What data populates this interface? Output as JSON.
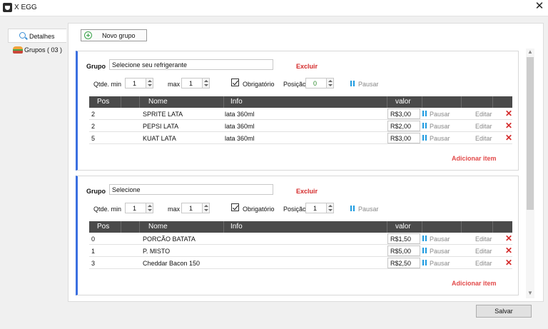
{
  "window": {
    "title": "X EGG",
    "close_glyph": "✕"
  },
  "nav": {
    "items": [
      {
        "label": "Detalhes",
        "icon": "search-icon",
        "active": true
      },
      {
        "label": "Grupos  ( 03 )",
        "icon": "burger-icon",
        "active": false
      }
    ]
  },
  "toolbar": {
    "new_group_label": "Novo grupo"
  },
  "labels": {
    "grupo": "Grupo",
    "excluir": "Excluir",
    "qtde_min": "Qtde. min",
    "max": "max",
    "obrigatorio": "Obrigatório",
    "posicao": "Posição",
    "pausar": "Pausar",
    "editar": "Editar",
    "adicionar_item": "Adicionar item"
  },
  "table_headers": [
    "Pos",
    "Nome",
    "Info",
    "valor"
  ],
  "groups": [
    {
      "name": "Selecione seu refrigerante",
      "qtde_min": "1",
      "max": "1",
      "obrigatorio": true,
      "posicao": "0",
      "items": [
        {
          "pos": "2",
          "nome": "SPRITE LATA",
          "info": "lata 360ml",
          "valor": "R$3,00"
        },
        {
          "pos": "2",
          "nome": "PEPSI  LATA",
          "info": "lata 360ml",
          "valor": "R$2,00"
        },
        {
          "pos": "5",
          "nome": "KUAT LATA",
          "info": "lata 360ml",
          "valor": "R$3,00"
        }
      ]
    },
    {
      "name": "Selecione",
      "qtde_min": "1",
      "max": "1",
      "obrigatorio": true,
      "posicao": "1",
      "items": [
        {
          "pos": "0",
          "nome": "PORCÃO BATATA",
          "info": "",
          "valor": "R$1,50"
        },
        {
          "pos": "1",
          "nome": "P. MISTO",
          "info": "",
          "valor": "R$5,00"
        },
        {
          "pos": "3",
          "nome": "Cheddar Bacon 150",
          "info": "",
          "valor": "R$2,50"
        }
      ]
    }
  ],
  "footer": {
    "save_label": "Salvar"
  },
  "colors": {
    "accent_blue": "#3b6fe0",
    "danger": "#d42a2a",
    "pause_blue": "#1e9be0",
    "header_dark": "#4a4a4a"
  }
}
